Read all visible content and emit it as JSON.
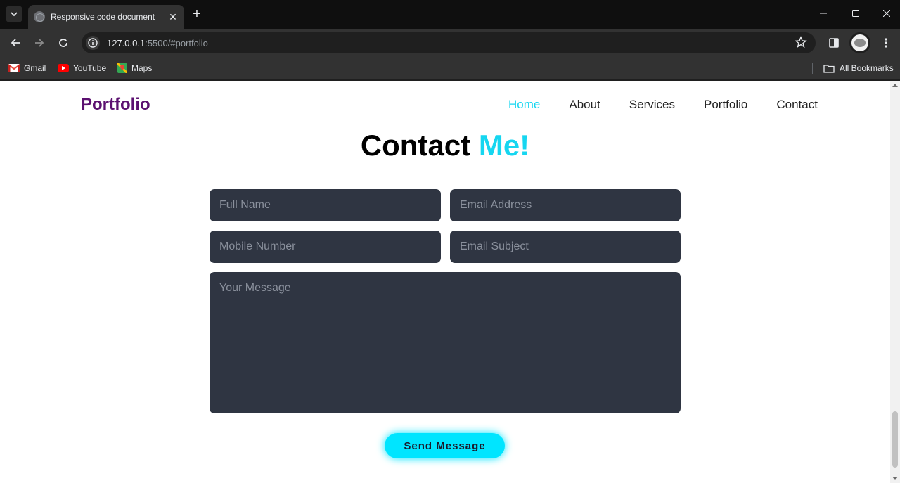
{
  "browser": {
    "tab_title": "Responsive code document",
    "url_host": "127.0.0.1",
    "url_rest": ":5500/#portfolio",
    "bookmarks": [
      {
        "label": "Gmail",
        "icon": "gmail-icon"
      },
      {
        "label": "YouTube",
        "icon": "youtube-icon"
      },
      {
        "label": "Maps",
        "icon": "maps-icon"
      }
    ],
    "all_bookmarks_label": "All Bookmarks"
  },
  "page": {
    "logo": "Portfolio",
    "nav": [
      {
        "label": "Home",
        "active": true
      },
      {
        "label": "About",
        "active": false
      },
      {
        "label": "Services",
        "active": false
      },
      {
        "label": "Portfolio",
        "active": false
      },
      {
        "label": "Contact",
        "active": false
      }
    ],
    "heading": {
      "main": "Contact",
      "accent": "Me!"
    },
    "form": {
      "full_name_placeholder": "Full Name",
      "email_placeholder": "Email Address",
      "mobile_placeholder": "Mobile Number",
      "subject_placeholder": "Email Subject",
      "message_placeholder": "Your Message",
      "submit_label": "Send Message"
    }
  },
  "colors": {
    "accent": "#16d6f0",
    "logo": "#5b1070",
    "field_bg": "#2f3542",
    "button": "#00e5ff"
  }
}
